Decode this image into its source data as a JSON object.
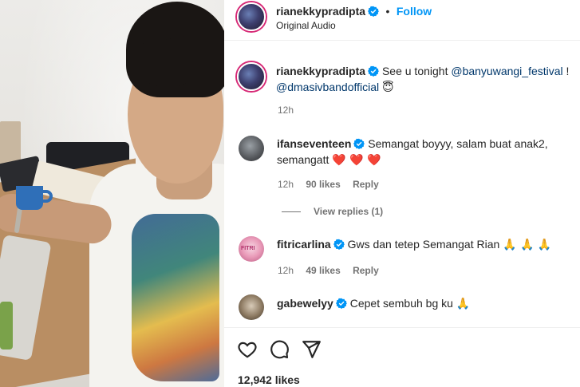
{
  "post": {
    "author": "rianekkypradipta",
    "follow_label": "Follow",
    "audio": "Original Audio",
    "caption_user": "rianekkypradipta",
    "caption_text_1": "See u tonight",
    "caption_mention_1": "@banyuwangi_festival",
    "caption_text_2": "!",
    "caption_mention_2": "@dmasivbandofficial",
    "caption_emoji": "😇",
    "caption_time": "12h"
  },
  "comments": [
    {
      "user": "ifanseventeen",
      "text_line1": "Semangat boyyy, salam buat anak2,",
      "text_line2": "semangatt",
      "emoji": "❤️ ❤️ ❤️",
      "time": "12h",
      "likes": "90 likes",
      "reply": "Reply"
    },
    {
      "user": "fitricarlina",
      "text": "Gws dan tetep Semangat Rian",
      "emoji": "🙏 🙏 🙏",
      "time": "12h",
      "likes": "49 likes",
      "reply": "Reply"
    },
    {
      "user": "gabewelyy",
      "text": "Cepet sembuh bg ku",
      "emoji": "🙏"
    }
  ],
  "view_replies": "View replies (1)",
  "actions": {
    "like_icon": "heart-icon",
    "comment_icon": "comment-icon",
    "share_icon": "share-icon"
  },
  "likes_count": "12,942 likes",
  "colors": {
    "follow_blue": "#0095f6",
    "verified_blue": "#0095f6",
    "heart_red": "#ed4956",
    "mention": "#00376b"
  }
}
